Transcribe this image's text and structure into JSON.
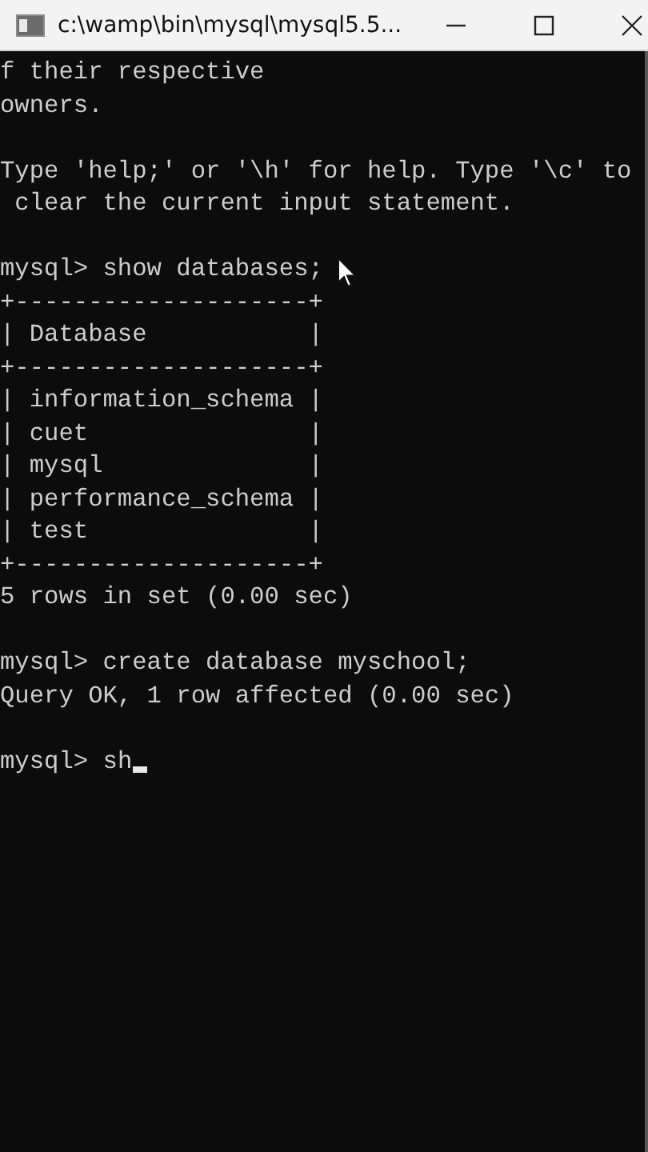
{
  "window": {
    "title": "c:\\wamp\\bin\\mysql\\mysql5.5..."
  },
  "console": {
    "blocks": [
      {
        "lines": [
          "f their respective",
          "owners."
        ]
      },
      {
        "lines": [
          "Type 'help;' or '\\h' for help. Type '\\c' to",
          " clear the current input statement."
        ]
      },
      {
        "lines": [
          "mysql> show databases;",
          "+--------------------+",
          "| Database           |",
          "+--------------------+",
          "| information_schema |",
          "| cuet               |",
          "| mysql              |",
          "| performance_schema |",
          "| test               |",
          "+--------------------+",
          "5 rows in set (0.00 sec)"
        ]
      },
      {
        "lines": [
          "mysql> create database myschool;",
          "Query OK, 1 row affected (0.00 sec)"
        ]
      }
    ],
    "input": {
      "prompt": "mysql>",
      "value": "sh"
    }
  }
}
